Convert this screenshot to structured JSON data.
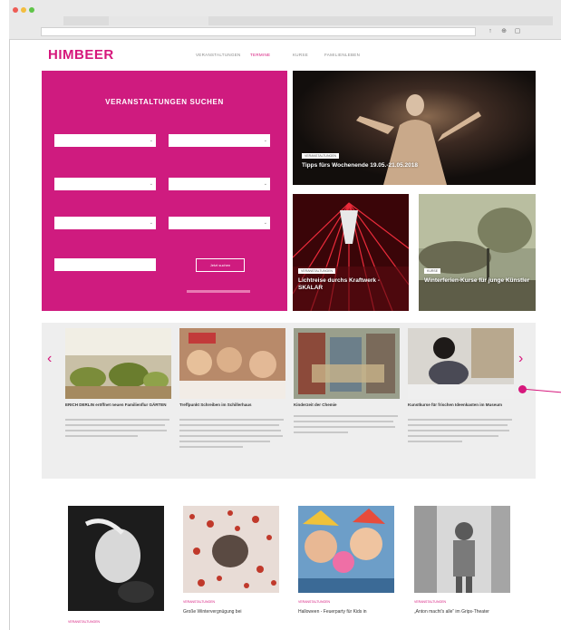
{
  "site": {
    "logo": "HIMBEER",
    "nav": [
      "VERANSTALTUNGEN",
      "TERMINE",
      "KURSE",
      "FAMILIENLEBEN"
    ]
  },
  "search": {
    "title": "VERANSTALTUNGEN SUCHEN",
    "submit_label": "Jetzt suchen"
  },
  "featured": [
    {
      "tag": "VERANSTALTUNGEN",
      "title": "Tipps fürs Wochenende 19.05.-21.05.2018"
    },
    {
      "tag": "VERANSTALTUNGEN",
      "title": "Lichtreise durchs Kraftwerk - SKALAR"
    },
    {
      "tag": "KURSE",
      "title": "Winterferien-Kurse für junge Künstler"
    }
  ],
  "carousel": {
    "items": [
      {
        "title": "ERICH DERLIN eröffnet neuen Familienflur GÄRTEN"
      },
      {
        "title": "Treffpunkt Schreiben im Schillerhaus"
      },
      {
        "title": "Kinderzeit der Chemie"
      },
      {
        "title": "Kunstkurse für frischen Ideenkasten im Museum"
      }
    ]
  },
  "bottom": [
    {
      "tag": "VERANSTALTUNGEN",
      "title": ""
    },
    {
      "tag": "VERANSTALTUNGEN",
      "title": "Große Wintervergnügung bei"
    },
    {
      "tag": "VERANSTALTUNGEN",
      "title": "Halloween - Feuerparty für Kids in"
    },
    {
      "tag": "VERANSTALTUNGEN",
      "title": "„Anton macht's alle“ im Grips-Theater"
    }
  ],
  "colors": {
    "brand": "#d6177c",
    "search_bg": "#cf1b7f"
  }
}
